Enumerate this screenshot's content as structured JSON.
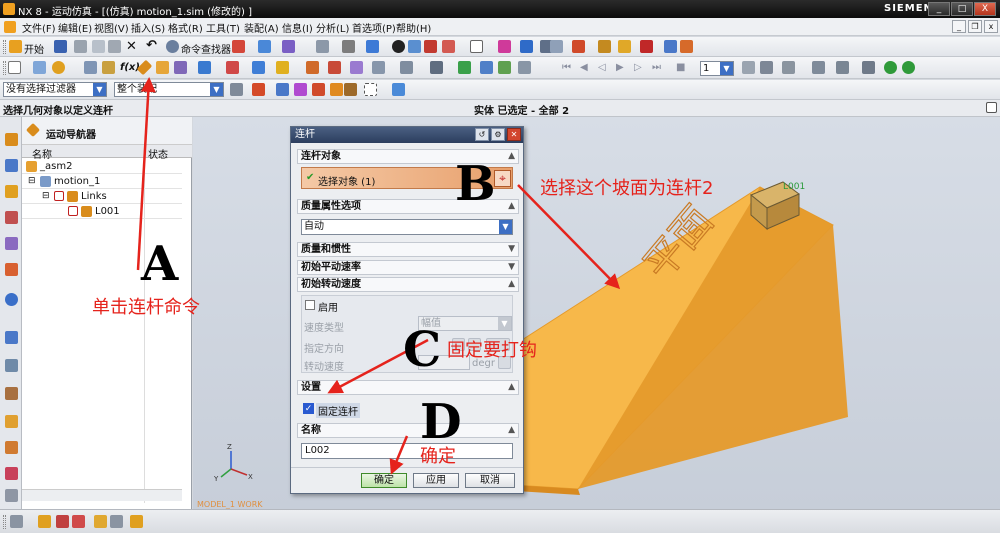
{
  "window": {
    "title": "NX 8 - 运动仿真 - [(仿真) motion_1.sim  (修改的) ]",
    "brand": "SIEMENS",
    "btn_min": "_",
    "btn_max": "□",
    "btn_close": "X"
  },
  "menubar": {
    "items": [
      "文件(F)",
      "编辑(E)",
      "视图(V)",
      "插入(S)",
      "格式(R)",
      "工具(T)",
      "装配(A)",
      "信息(I)",
      "分析(L)",
      "首选项(P)",
      "帮助(H)"
    ],
    "mdi_min": "_",
    "mdi_restore": "❐",
    "mdi_close": "x"
  },
  "toolbar1": {
    "start_label": "开始",
    "cmd_finder_label": "命令查找器"
  },
  "toolbar2": {
    "fx_label": "f(x)",
    "step_value": "1"
  },
  "selection_bar": {
    "filter_value": "没有选择过滤器",
    "scope_value": "整个装配"
  },
  "cue_line": {
    "left": "选择几何对象以定义连杆",
    "center": "实体 已选定 - 全部 2"
  },
  "navigator": {
    "title": "运动导航器",
    "col_name": "名称",
    "col_status": "状态",
    "tree": [
      {
        "label": "_asm2",
        "indent": 0
      },
      {
        "label": "motion_1",
        "indent": 1
      },
      {
        "label": "Links",
        "indent": 2
      },
      {
        "label": "L001",
        "indent": 3
      }
    ]
  },
  "viewport": {
    "part_label": "L001",
    "face_text": "平面",
    "work_label": "MODEL_1 WORK"
  },
  "dialog": {
    "title": "连杆",
    "sec_link_object": "连杆对象",
    "select_object": "选择对象 (1)",
    "sec_mass_options": "质量属性选项",
    "mass_value": "自动",
    "sec_mass_inertia": "质量和惯性",
    "sec_init_trans": "初始平动速率",
    "sec_init_rot": "初始转动速度",
    "enable_label": "启用",
    "speed_type_label": "速度类型",
    "speed_type_value": "幅值",
    "direction_label": "指定方向",
    "rot_speed_label": "转动速度",
    "rot_speed_unit": "degr",
    "sec_settings": "设置",
    "fixed_link_label": "固定连杆",
    "sec_name": "名称",
    "name_value": "L002",
    "ok": "确定",
    "apply": "应用",
    "cancel": "取消"
  },
  "annotations": {
    "letter_a": "A",
    "letter_b": "B",
    "letter_c": "C",
    "letter_d": "D",
    "text_a": "单击连杆命令",
    "text_b": "选择这个坡面为连杆2",
    "text_c": "固定要打钩",
    "text_d": "确定",
    "color": "#e5231c"
  },
  "colors": {
    "wedge_top": "#f7b84a",
    "wedge_side": "#e59a2b",
    "select_row": "#e8a06c",
    "accent_blue": "#3d6fc4"
  }
}
